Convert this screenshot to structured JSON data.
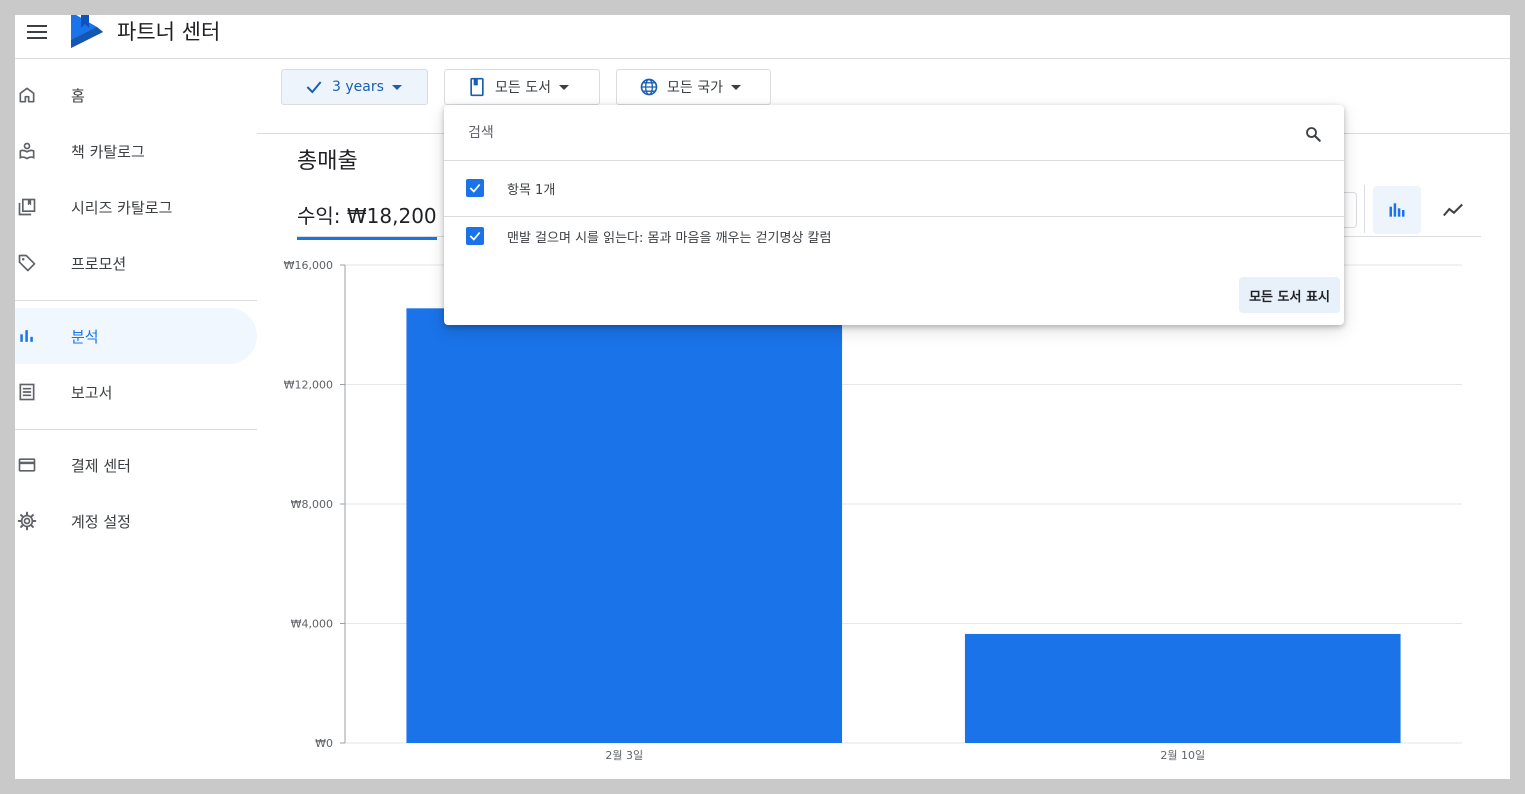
{
  "app": {
    "title": "파트너 센터",
    "brand_color": "#1a73e8"
  },
  "sidebar": {
    "items": [
      {
        "label": "홈",
        "icon": "home-icon"
      },
      {
        "label": "책 카탈로그",
        "icon": "book-catalog-icon"
      },
      {
        "label": "시리즈 카탈로그",
        "icon": "series-catalog-icon"
      },
      {
        "label": "프로모션",
        "icon": "tag-icon"
      },
      {
        "label": "분석",
        "icon": "bar-chart-icon",
        "active": true
      },
      {
        "label": "보고서",
        "icon": "report-icon"
      },
      {
        "label": "결제 센터",
        "icon": "credit-card-icon"
      },
      {
        "label": "계정 설정",
        "icon": "gear-icon"
      }
    ]
  },
  "filters": {
    "period": "3 years",
    "books": "모든 도서",
    "countries": "모든 국가"
  },
  "main": {
    "section_title": "총매출",
    "metric_tab": "수익: ₩18,200"
  },
  "dropdown": {
    "search_placeholder": "검색",
    "select_all_label": "항목 1개",
    "items": [
      {
        "label": "맨발 걸으며 시를 읽는다: 몸과 마음을 깨우는 걷기명상 칼럼",
        "checked": true
      }
    ],
    "show_all_label": "모든 도서 표시"
  },
  "chart_data": {
    "type": "bar",
    "categories": [
      "2월 3일",
      "2월 10일"
    ],
    "values": [
      14550,
      3650
    ],
    "y_ticks": [
      "₩0",
      "₩4,000",
      "₩8,000",
      "₩12,000",
      "₩16,000"
    ],
    "ylim": [
      0,
      16000
    ],
    "title": "",
    "xlabel": "",
    "ylabel": "",
    "bar_color": "#1a73e8",
    "grid": true
  }
}
